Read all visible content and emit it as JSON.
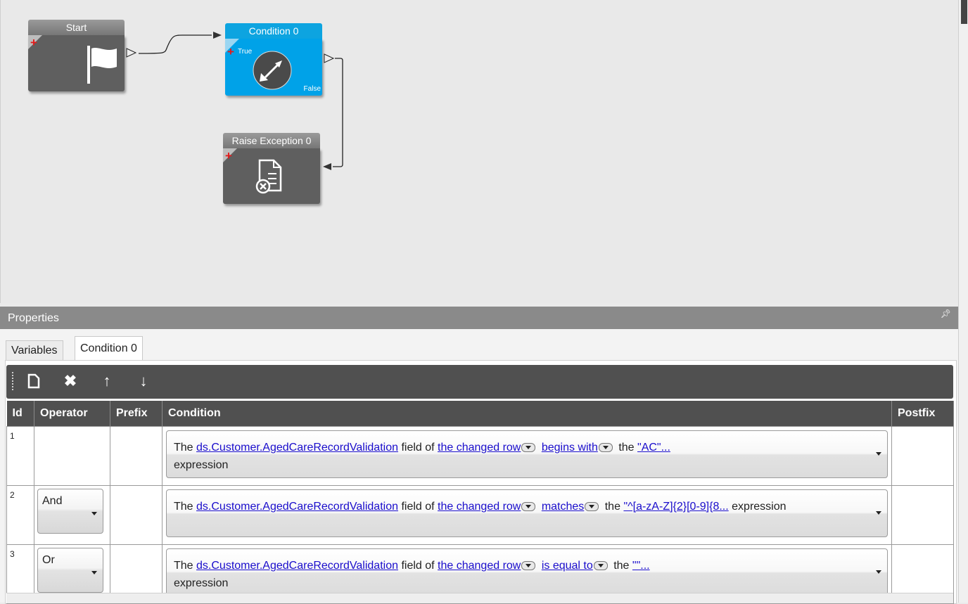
{
  "canvas": {
    "nodes": {
      "start": {
        "title": "Start",
        "icon": "flag-icon"
      },
      "condition": {
        "title": "Condition 0",
        "true_label": "True",
        "false_label": "False",
        "icon": "condition-arrows-icon"
      },
      "raise": {
        "title": "Raise Exception 0",
        "icon": "document-error-icon"
      }
    }
  },
  "properties": {
    "title": "Properties",
    "pin_icon": "pin-icon",
    "tabs": [
      {
        "label": "Variables",
        "active": false
      },
      {
        "label": "Condition 0",
        "active": true
      }
    ],
    "toolbar": {
      "new_icon": "new-document-icon",
      "delete_icon": "delete-x-icon",
      "up_icon": "arrow-up-icon",
      "down_icon": "arrow-down-icon"
    },
    "grid": {
      "columns": [
        "Id",
        "Operator",
        "Prefix",
        "Condition",
        "Postfix"
      ],
      "rows": [
        {
          "id": "1",
          "operator": "",
          "prefix": "",
          "cond": {
            "the1": "The",
            "field": "ds.Customer.AgedCareRecordValidation",
            "fieldof": "field of",
            "row": "the changed row",
            "op": "begins with",
            "the2": "the",
            "value": "\"AC\"...",
            "tail": "expression"
          },
          "postfix": ""
        },
        {
          "id": "2",
          "operator": "And",
          "prefix": "",
          "cond": {
            "the1": "The",
            "field": "ds.Customer.AgedCareRecordValidation",
            "fieldof": "field of",
            "row": "the changed row",
            "op": "matches",
            "the2": "the",
            "value": "\"^[a-zA-Z]{2}[0-9]{8...",
            "tail": "expression"
          },
          "postfix": ""
        },
        {
          "id": "3",
          "operator": "Or",
          "prefix": "",
          "cond": {
            "the1": "The",
            "field": "ds.Customer.AgedCareRecordValidation",
            "fieldof": "field of",
            "row": "the changed row",
            "op": "is equal to",
            "the2": "the",
            "value": "\"\"...",
            "tail": "expression"
          },
          "postfix": ""
        }
      ]
    }
  }
}
